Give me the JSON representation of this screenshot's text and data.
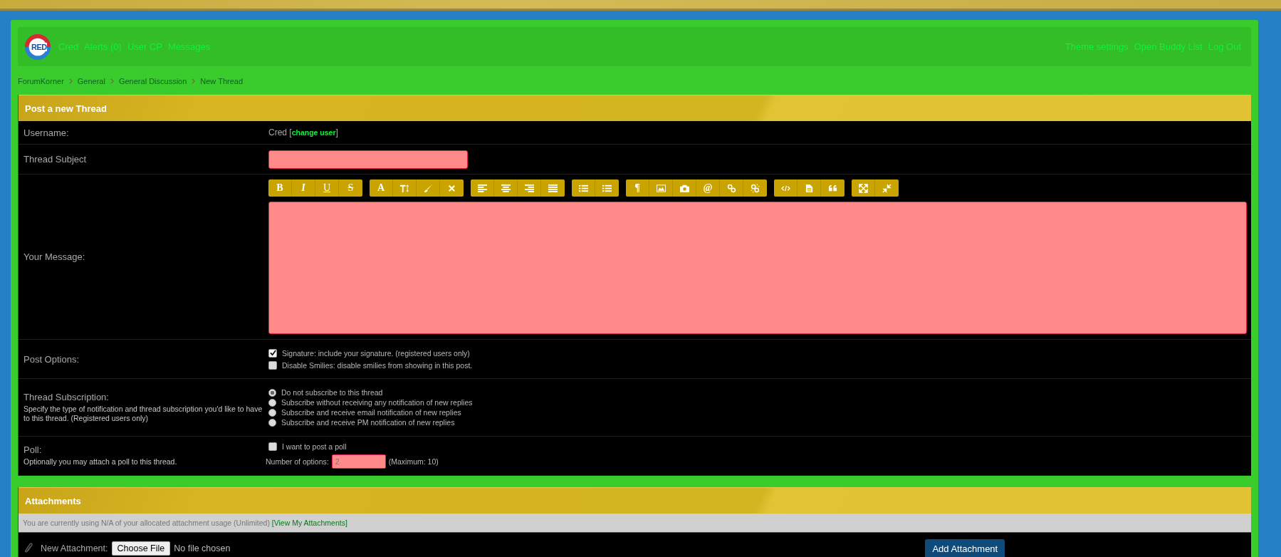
{
  "header": {
    "logo_text": "RED",
    "left_links": [
      "Cred",
      "Alerts (0)",
      "User CP",
      "Messages"
    ],
    "right_links": [
      "Theme settings",
      "Open Buddy List",
      "Log Out"
    ]
  },
  "breadcrumb": [
    "ForumKorner",
    "General",
    "General Discussion",
    "New Thread"
  ],
  "post_panel": {
    "title": "Post a new Thread",
    "username": {
      "label": "Username:",
      "value": "Cred",
      "link_open": "[",
      "link": "change user",
      "link_close": "]"
    },
    "subject": {
      "label": "Thread Subject"
    },
    "message": {
      "label": "Your Message:",
      "toolbar": [
        [
          {
            "kind": "bold",
            "label": "B"
          },
          {
            "kind": "italic",
            "label": "I"
          },
          {
            "kind": "underline",
            "label": "U"
          },
          {
            "kind": "strike",
            "label": "S"
          }
        ],
        [
          {
            "kind": "color",
            "label": "A"
          },
          {
            "kind": "font-size"
          },
          {
            "kind": "brush"
          },
          {
            "kind": "clear"
          }
        ],
        [
          {
            "kind": "align-left"
          },
          {
            "kind": "align-center"
          },
          {
            "kind": "align-right"
          },
          {
            "kind": "justify"
          }
        ],
        [
          {
            "kind": "bullet-list"
          },
          {
            "kind": "numbered-list"
          }
        ],
        [
          {
            "kind": "paragraph",
            "label": "¶"
          },
          {
            "kind": "image"
          },
          {
            "kind": "camera"
          },
          {
            "kind": "email",
            "label": "@"
          },
          {
            "kind": "link"
          },
          {
            "kind": "unlink"
          }
        ],
        [
          {
            "kind": "code"
          },
          {
            "kind": "document"
          },
          {
            "kind": "quote"
          }
        ],
        [
          {
            "kind": "maximize"
          },
          {
            "kind": "minimize"
          }
        ]
      ]
    },
    "post_options": {
      "label": "Post Options:",
      "options": [
        {
          "text": "Signature: include your signature. (registered users only)",
          "checked": true
        },
        {
          "text": "Disable Smilies: disable smilies from showing in this post.",
          "checked": false
        }
      ]
    },
    "subscription": {
      "label": "Thread Subscription:",
      "description": "Specify the type of notification and thread subscription you'd like to have to this thread. (Registered users only)",
      "options": [
        {
          "text": "Do not subscribe to this thread",
          "selected": true
        },
        {
          "text": "Subscribe without receiving any notification of new replies",
          "selected": false
        },
        {
          "text": "Subscribe and receive email notification of new replies",
          "selected": false
        },
        {
          "text": "Subscribe and receive PM notification of new replies",
          "selected": false
        }
      ]
    },
    "poll": {
      "label": "Poll:",
      "description": "Optionally you may attach a poll to this thread.",
      "checkbox": {
        "text": "I want to post a poll",
        "checked": false
      },
      "options_label": "Number of options:",
      "options_value": "2",
      "maximum": "(Maximum: 10)"
    }
  },
  "attachments_panel": {
    "title": "Attachments",
    "usage_text": "You are currently using N/A of your allocated attachment usage (Unlimited)",
    "usage_link": "[View My Attachments]",
    "new_label": "New Attachment:",
    "choose_button": "Choose File",
    "file_status": "No file chosen",
    "add_button": "Add Attachment"
  }
}
